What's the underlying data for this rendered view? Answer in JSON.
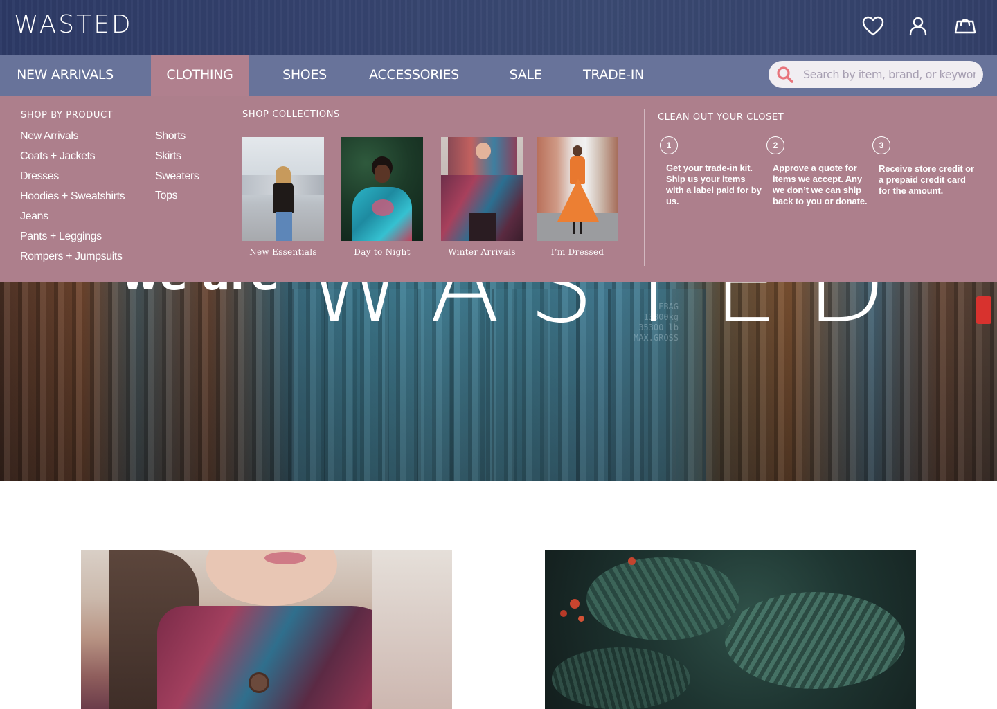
{
  "header": {
    "logo": "WASTED",
    "icons": [
      "heart-icon",
      "user-icon",
      "shopping-bag-icon"
    ]
  },
  "nav": {
    "items": [
      {
        "label": "NEW ARRIVALS",
        "active": false
      },
      {
        "label": "CLOTHING",
        "active": true
      },
      {
        "label": "SHOES",
        "active": false
      },
      {
        "label": "ACCESSORIES",
        "active": false
      },
      {
        "label": "SALE",
        "active": false
      },
      {
        "label": "TRADE-IN",
        "active": false
      }
    ],
    "search": {
      "placeholder": "Search by item, brand, or keyword",
      "value": ""
    }
  },
  "dropdown": {
    "shop_by_product": {
      "heading": "SHOP BY PRODUCT",
      "column1": [
        "New Arrivals",
        "Coats + Jackets",
        "Dresses",
        "Hoodies + Sweatshirts",
        "Jeans",
        "Pants + Leggings",
        "Rompers + Jumpsuits"
      ],
      "column2": [
        "Shorts",
        "Skirts",
        "Sweaters",
        "Tops"
      ]
    },
    "shop_collections": {
      "heading": "SHOP COLLECTIONS",
      "items": [
        {
          "caption": "New Essentials"
        },
        {
          "caption": "Day to Night"
        },
        {
          "caption": "Winter Arrivals"
        },
        {
          "caption": "I’m Dressed"
        }
      ]
    },
    "closet": {
      "heading": "CLEAN OUT YOUR CLOSET",
      "steps": [
        {
          "number": "1",
          "text": "Get your trade-in kit. Ship us your items with a label paid for by us."
        },
        {
          "number": "2",
          "text": "Approve a quote for items we accept. Any we don’t we can ship back to you  or donate."
        },
        {
          "number": "3",
          "text": "Receive store credit or a prepaid credit card for the amount."
        }
      ]
    }
  },
  "hero": {
    "subtitle": "we are",
    "title": "WASTED",
    "stencil": "LEBAG\n13800kg\n35300 lb\nMAX.GROSS"
  },
  "colors": {
    "header_bg": "#36446f",
    "nav_bg": "#68739a",
    "dropdown_bg": "#ad7f8c",
    "active_tab": "#b0808e",
    "search_icon": "#e8747c"
  }
}
